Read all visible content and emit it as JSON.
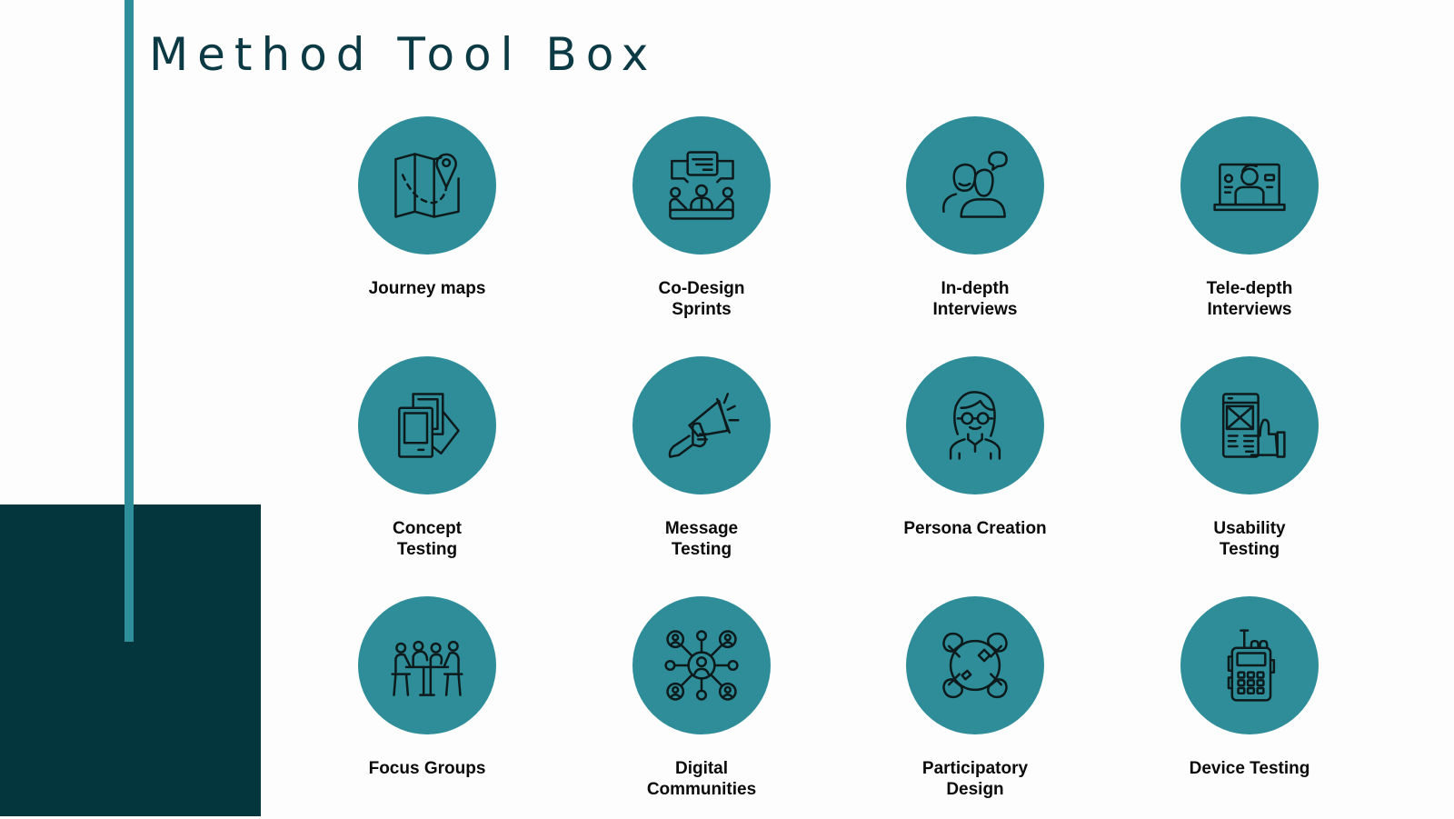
{
  "slide": {
    "title": "Method Tool Box",
    "colors": {
      "background": "#fdfdfd",
      "accent_teal": "#2e8d98",
      "dark_teal": "#04363e",
      "title_text": "#0b3a44",
      "label_text": "#0a0a0a",
      "icon_stroke": "#0d1a1c"
    }
  },
  "methods": [
    {
      "label": "Journey maps",
      "icon": "folded-map-with-pin-icon"
    },
    {
      "label": "Co-Design\nSprints",
      "icon": "team-meeting-speech-bubbles-icon"
    },
    {
      "label": "In-depth\nInterviews",
      "icon": "two-people-conversation-icon"
    },
    {
      "label": "Tele-depth\nInterviews",
      "icon": "laptop-video-call-icon"
    },
    {
      "label": "Concept\nTesting",
      "icon": "stacked-cards-icon"
    },
    {
      "label": "Message\nTesting",
      "icon": "megaphone-in-hand-icon"
    },
    {
      "label": "Persona Creation",
      "icon": "woman-with-glasses-icon"
    },
    {
      "label": "Usability\nTesting",
      "icon": "phone-wireframe-thumbs-up-icon"
    },
    {
      "label": "Focus Groups",
      "icon": "people-around-table-icon"
    },
    {
      "label": "Digital\nCommunities",
      "icon": "network-of-people-icon"
    },
    {
      "label": "Participatory\nDesign",
      "icon": "hands-joined-circle-icon"
    },
    {
      "label": "Device Testing",
      "icon": "walkie-talkie-device-icon"
    }
  ]
}
